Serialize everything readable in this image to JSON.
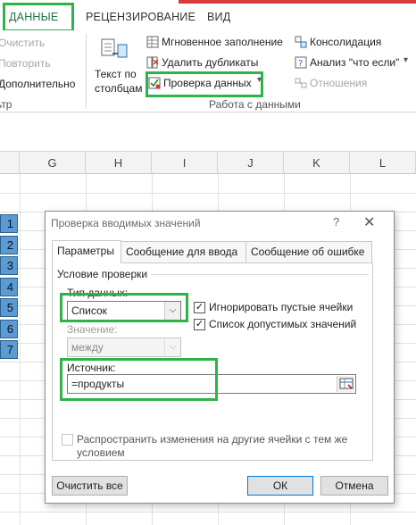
{
  "ribbon_tabs": [
    "ДАННЫЕ",
    "РЕЦЕНЗИРОВАНИЕ",
    "ВИД"
  ],
  "ribbon": {
    "left_items": [
      "Очистить",
      "Повторить",
      "Дополнительно"
    ],
    "left_group_label": "ьтр",
    "text_to_columns": [
      "Текст по",
      "столбцам"
    ],
    "flash_fill": "Мгновенное заполнение",
    "remove_duplicates": "Удалить дубликаты",
    "data_validation": "Проверка данных",
    "consolidate": "Консолидация",
    "what_if": "Анализ \"что если\"",
    "relationships": "Отношения",
    "group_label": "Работа с данными"
  },
  "columns": [
    "G",
    "H",
    "I",
    "J",
    "K",
    "L"
  ],
  "row_numbers": [
    "1",
    "2",
    "3",
    "4",
    "5",
    "6",
    "7"
  ],
  "dialog": {
    "title": "Проверка вводимых значений",
    "help": "?",
    "close": "✕",
    "tabs": [
      "Параметры",
      "Сообщение для ввода",
      "Сообщение об ошибке"
    ],
    "group_title": "Условие проверки",
    "data_type_label": "Тип данных:",
    "data_type_value": "Список",
    "ignore_blank": "Игнорировать пустые ячейки",
    "in_cell_dropdown": "Список допустимых значений",
    "value_label": "Значение:",
    "value_value": "между",
    "source_label": "Источник:",
    "source_value": "=продукты",
    "apply_all_line1": "Распространить изменения на другие ячейки с тем же",
    "apply_all_line2": "условием",
    "clear_all": "Очистить все",
    "ok": "ОК",
    "cancel": "Отмена"
  },
  "colors": {
    "accent": "#217346",
    "highlight": "#2db34a",
    "cell_fill": "#5b9bd5"
  },
  "icons": {
    "dropdown": "▾",
    "combo_arrow": "⌵",
    "check": "✓"
  }
}
